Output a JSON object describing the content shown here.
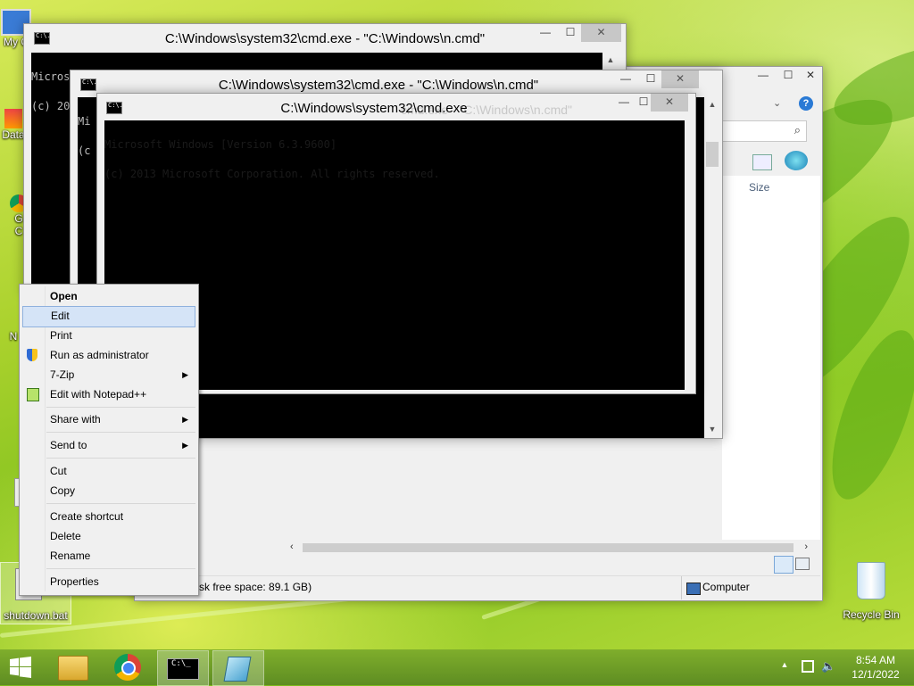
{
  "windows": {
    "cmd1_title": "C:\\Windows\\system32\\cmd.exe - \"C:\\Windows\\n.cmd\"",
    "cmd2_title": "C:\\Windows\\system32\\cmd.exe - \"C:\\Windows\\n.cmd\"",
    "cmd3_title": "C:\\Windows\\system32\\cmd.exe",
    "cmd3_ghost_title": "cmd.exe - \"C:\\Windows\\n.cmd\"",
    "console_line1": "Microsoft Windows [Version 6.3.9600]",
    "console_line2": "(c) 2013 Microsoft Corporation. All rights reserved.",
    "cmd2_line1": "Mi",
    "cmd2_line2": "(c"
  },
  "explorer": {
    "column_size": "Size",
    "status_free": "sk free space: 89.1 GB)",
    "status_location": "Computer"
  },
  "context_menu": {
    "open": "Open",
    "edit": "Edit",
    "print": "Print",
    "run_as_admin": "Run as administrator",
    "seven_zip": "7-Zip",
    "notepadpp": "Edit with Notepad++",
    "share_with": "Share with",
    "send_to": "Send to",
    "cut": "Cut",
    "copy": "Copy",
    "create_shortcut": "Create shortcut",
    "delete": "Delete",
    "rename": "Rename",
    "properties": "Properties",
    "submenu_arrow": "▶"
  },
  "desktop_icons": {
    "my_computer": "My C",
    "data": "Data",
    "g1": "G",
    "g2": "C",
    "n": "N",
    "shutdown": "shutdown.bat",
    "recycle_bin": "Recycle Bin"
  },
  "tray": {
    "time": "8:54 AM",
    "date": "12/1/2022",
    "up_arrow": "▲"
  },
  "icons": {
    "start": "windows-logo-icon",
    "explorer": "folder-icon",
    "chrome": "chrome-icon",
    "cmd": "console-icon",
    "notepad": "notepad-icon"
  }
}
